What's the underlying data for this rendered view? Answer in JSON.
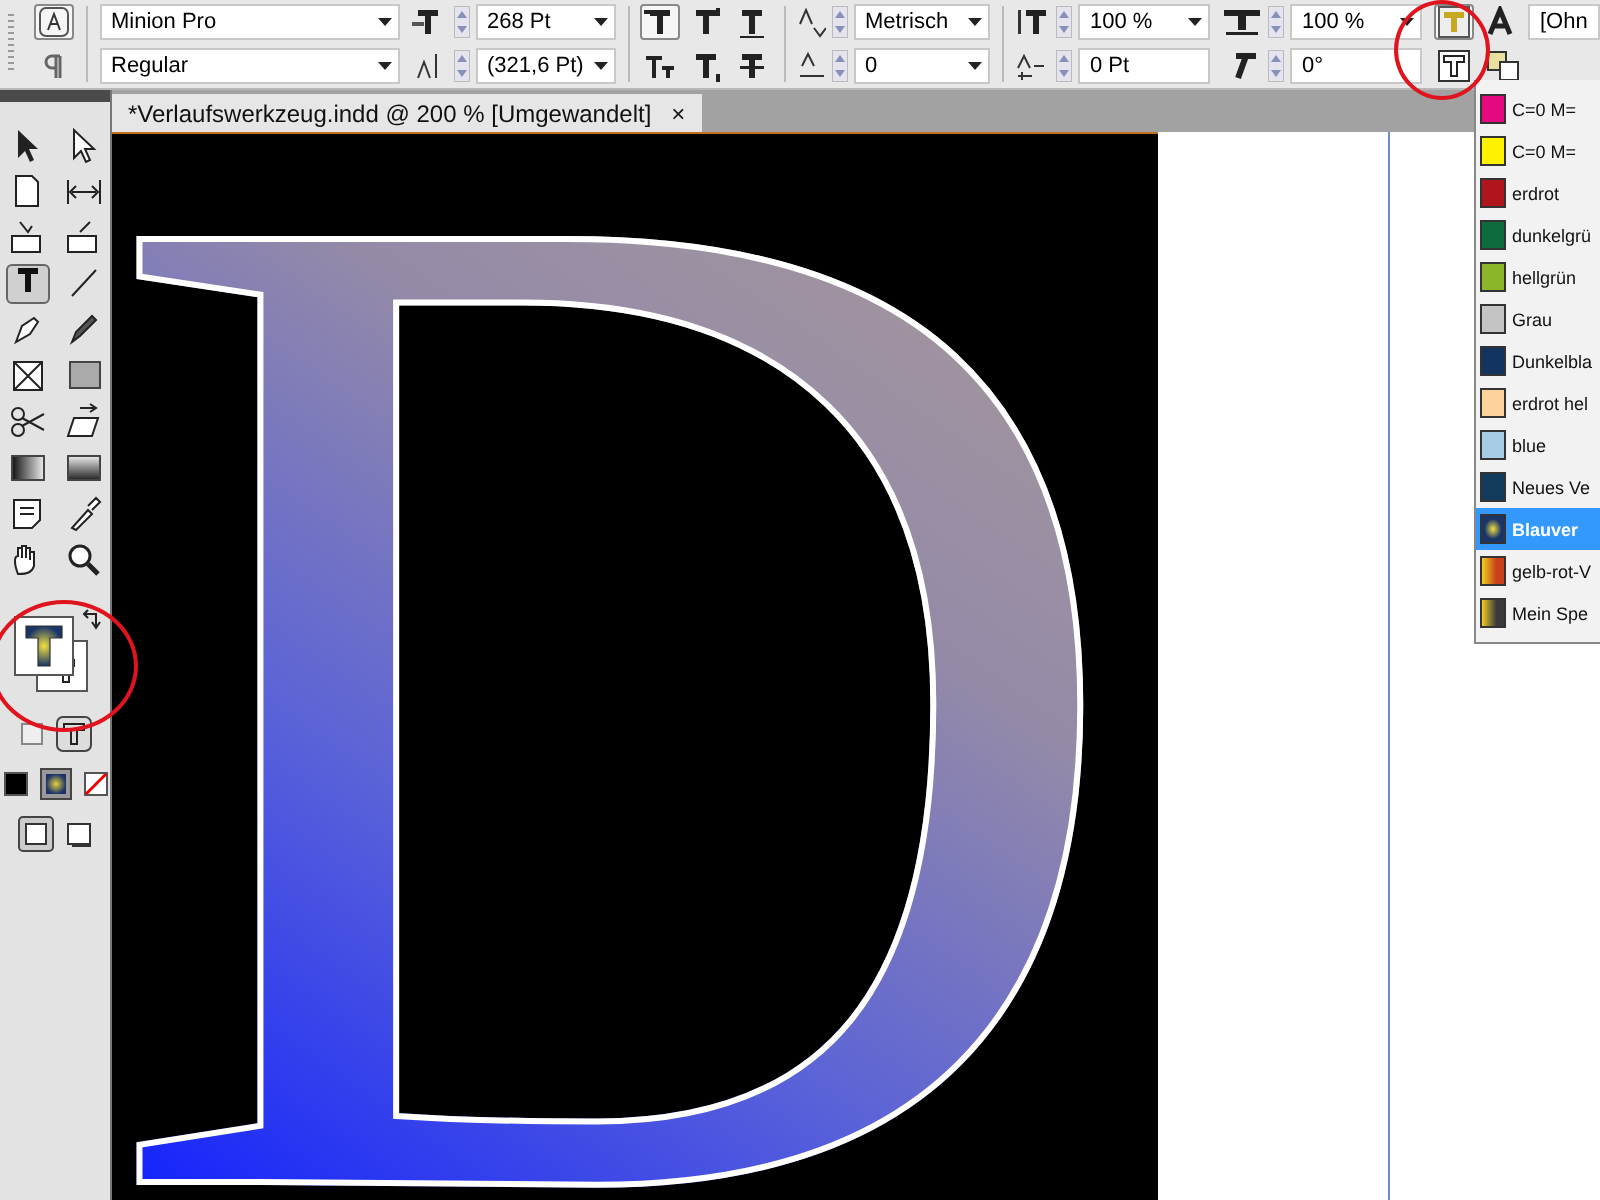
{
  "control_bar": {
    "mode_buttons": [
      {
        "selected": true
      },
      {
        "selected": false
      }
    ],
    "font_family": "Minion Pro",
    "font_style": "Regular",
    "font_size": "268 Pt",
    "leading": "(321,6 Pt)",
    "case_buttons": [
      {
        "selected": true
      },
      {
        "selected": false
      },
      {
        "selected": false
      },
      {
        "selected": false
      },
      {
        "selected": false
      },
      {
        "selected": false
      }
    ],
    "kerning": "Metrisch",
    "tracking": "0",
    "vertical_scale": "100 %",
    "baseline_shift": "0 Pt",
    "horizontal_scale": "100 %",
    "skew": "0°",
    "format_target": [
      {
        "selected": true
      },
      {
        "selected": false
      }
    ],
    "character_style": "[Ohn"
  },
  "document_tab": {
    "title": "*Verlaufswerkzeug.indd @ 200 % [Umgewandelt]",
    "close": "×"
  },
  "toolbox": {
    "tools": [
      {
        "selected": false
      },
      {
        "selected": false
      },
      {
        "selected": false
      },
      {
        "selected": false
      },
      {
        "selected": false
      },
      {
        "selected": false
      },
      {
        "selected": true
      },
      {
        "selected": false
      },
      {
        "selected": false
      },
      {
        "selected": false
      },
      {
        "selected": false
      },
      {
        "selected": false
      },
      {
        "selected": false
      },
      {
        "selected": false
      },
      {
        "selected": false
      },
      {
        "selected": false
      },
      {
        "selected": false
      },
      {
        "selected": false
      },
      {
        "selected": false
      },
      {
        "selected": false
      }
    ]
  },
  "canvas": {
    "letter": "D"
  },
  "swatches": [
    {
      "name": "C=0 M=",
      "kind": "solid",
      "color": "#e5097f",
      "selected": false
    },
    {
      "name": "C=0 M=",
      "kind": "solid",
      "color": "#fff200",
      "selected": false
    },
    {
      "name": "erdrot",
      "kind": "solid",
      "color": "#b0141c",
      "selected": false
    },
    {
      "name": "dunkelgrü",
      "kind": "solid",
      "color": "#0d6b3d",
      "selected": false
    },
    {
      "name": "hellgrün",
      "kind": "solid",
      "color": "#8db52a",
      "selected": false
    },
    {
      "name": "Grau",
      "kind": "solid",
      "color": "#c4c4c4",
      "selected": false
    },
    {
      "name": "Dunkelbla",
      "kind": "solid",
      "color": "#12345e",
      "selected": false
    },
    {
      "name": "erdrot hel",
      "kind": "solid",
      "color": "#fdd39b",
      "selected": false
    },
    {
      "name": "blue",
      "kind": "solid",
      "color": "#a7cde6",
      "selected": false
    },
    {
      "name": "Neues Ve",
      "kind": "solid",
      "color": "#123a5c",
      "selected": false
    },
    {
      "name": "Blauver",
      "kind": "gradient",
      "color": "#1a3468",
      "selected": true
    },
    {
      "name": "gelb-rot-V",
      "kind": "gradient",
      "color": "#c7401a",
      "selected": false
    },
    {
      "name": "Mein Spe",
      "kind": "gradient",
      "color": "#3a3a3a",
      "selected": false
    }
  ]
}
